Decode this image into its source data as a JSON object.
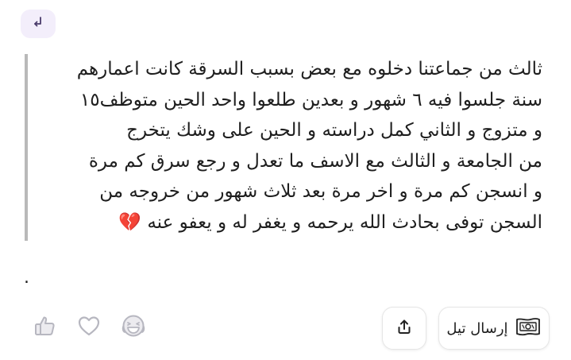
{
  "post": {
    "body": "ثالث من جماعتنا دخلوه مع بعض بسبب السرقة كانت اعمارهم\nسنة جلسوا فيه ٦ شهور و بعدين طلعوا واحد الحين متوظف١٥\nو متزوج و الثاني كمل دراسته و الحين على وشك يتخرج\nمن الجامعة و الثالث مع الاسف ما تعدل و رجع سرق كم مرة\nو انسجن كم مرة و اخر مرة بعد ثلاث شهور من خروجه من\nالسجن توفى بحادث الله يرحمه و يغفر له و يعفو عنه 💔",
    "trailing_mark": "."
  },
  "actions": {
    "send_tip_label": "إرسال تيل"
  },
  "icons": {
    "back": "reply-back-arrow-icon",
    "like": "thumbs-up-icon",
    "heart": "heart-icon",
    "laugh": "laughing-face-icon",
    "share": "share-upload-icon",
    "tip": "banknote-icon"
  },
  "colors": {
    "accent_bg": "#f3eefb",
    "icon_gray": "#b7b7c0",
    "quote_bar": "#b9b9b9"
  }
}
